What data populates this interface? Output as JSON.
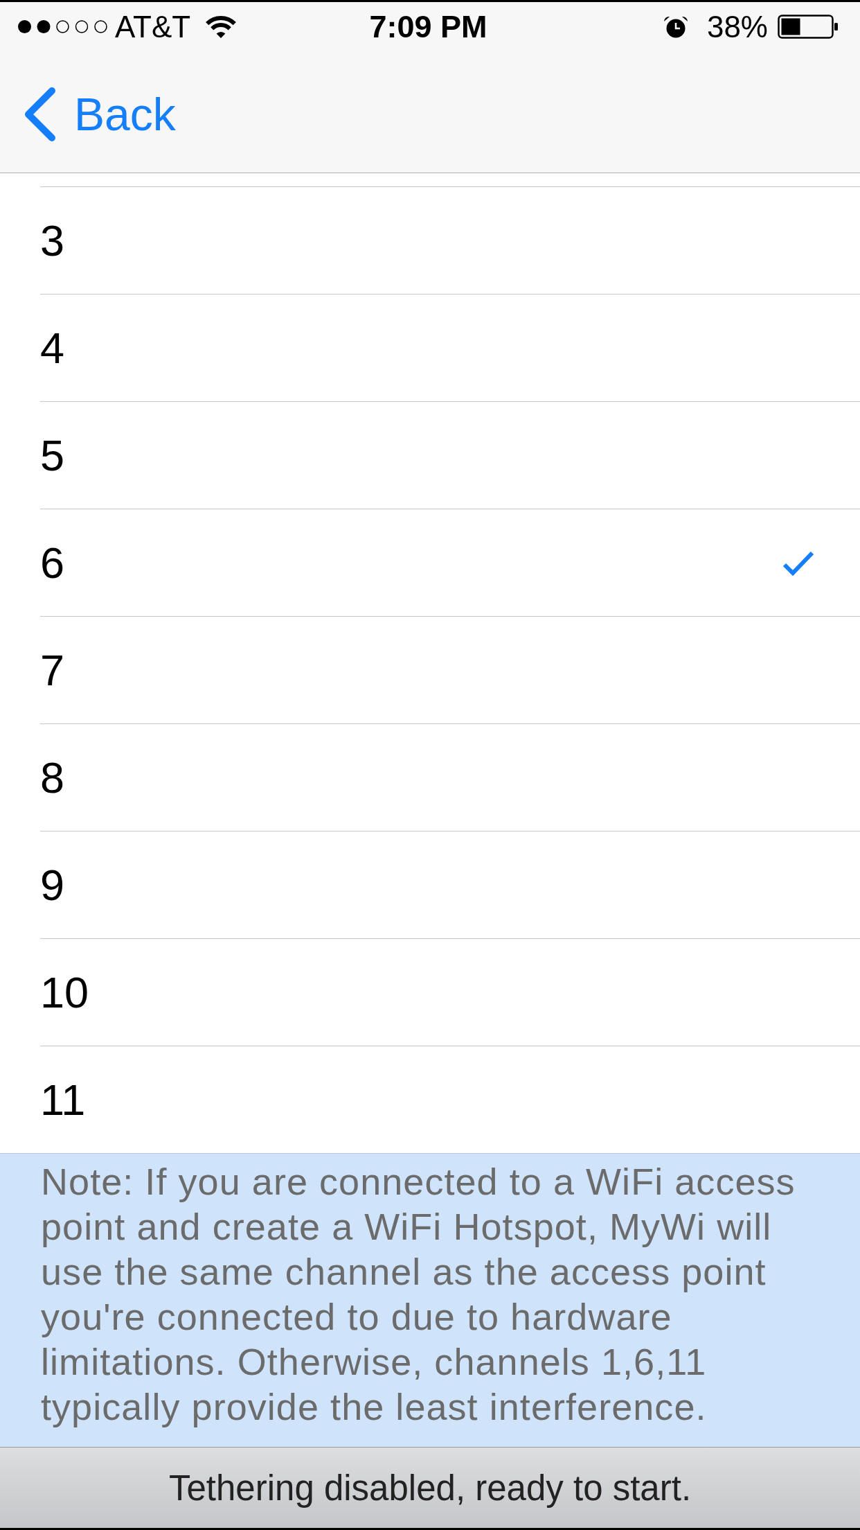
{
  "status_bar": {
    "carrier": "AT&T",
    "time": "7:09 PM",
    "battery": "38%"
  },
  "nav_bar": {
    "back_label": "Back"
  },
  "channels": [
    {
      "label": "3",
      "selected": false
    },
    {
      "label": "4",
      "selected": false
    },
    {
      "label": "5",
      "selected": false
    },
    {
      "label": "6",
      "selected": true
    },
    {
      "label": "7",
      "selected": false
    },
    {
      "label": "8",
      "selected": false
    },
    {
      "label": "9",
      "selected": false
    },
    {
      "label": "10",
      "selected": false
    },
    {
      "label": "11",
      "selected": false
    }
  ],
  "note": "Note: If you are connected to a WiFi access point and create a WiFi Hotspot, MyWi will use the same channel as the access point you're connected to due to hardware limitations. Otherwise, channels 1,6,11 typically provide the least interference.",
  "footer": {
    "status": "Tethering disabled, ready to start."
  }
}
